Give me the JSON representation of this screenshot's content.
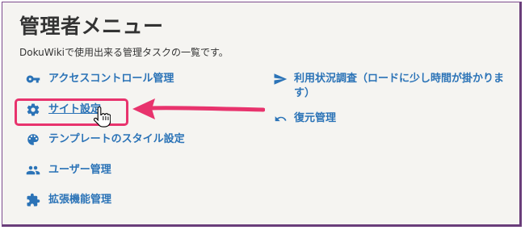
{
  "page": {
    "title": "管理者メニュー",
    "subtitle": "DokuWikiで使用出来る管理タスクの一覧です。"
  },
  "menu_left": [
    {
      "label": "アクセスコントロール管理",
      "icon": "key-icon"
    },
    {
      "label": "サイト設定",
      "icon": "gear-icon",
      "current": true
    },
    {
      "label": "テンプレートのスタイル設定",
      "icon": "palette-icon"
    },
    {
      "label": "ユーザー管理",
      "icon": "users-icon"
    },
    {
      "label": "拡張機能管理",
      "icon": "puzzle-icon"
    }
  ],
  "menu_right": [
    {
      "label": "利用状況調査（ロードに少し時間が掛かります）",
      "icon": "send-icon"
    },
    {
      "label": "復元管理",
      "icon": "revert-icon"
    }
  ],
  "colors": {
    "link": "#2b73b7",
    "highlight": "#e8336d",
    "background": "#f5f4f1"
  }
}
